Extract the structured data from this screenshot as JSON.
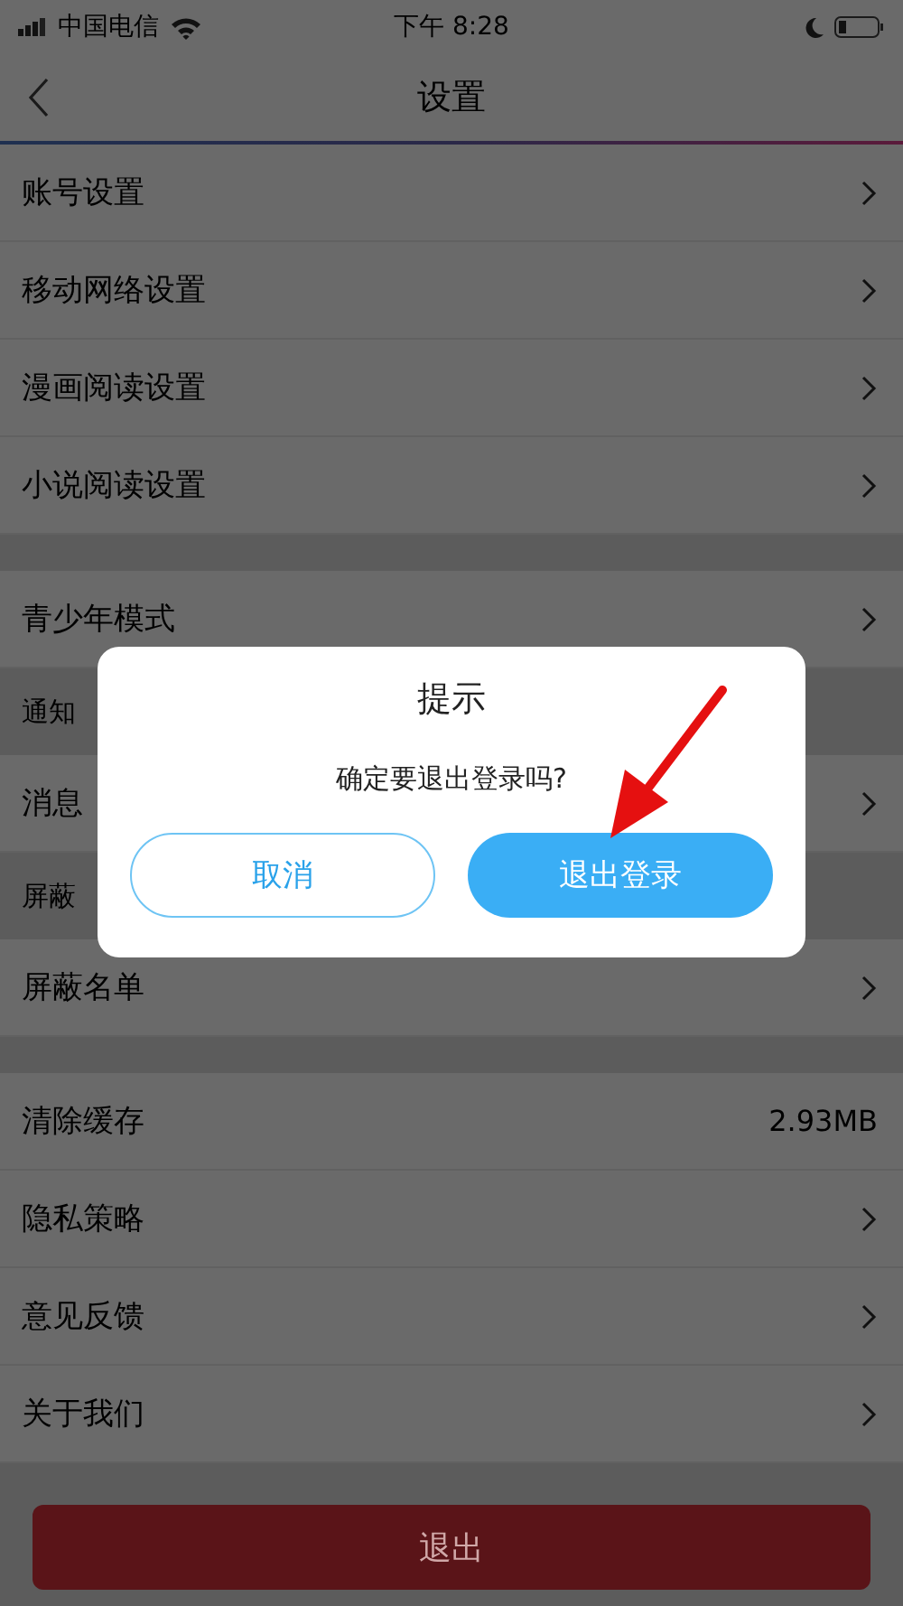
{
  "status_bar": {
    "carrier": "中国电信",
    "time": "下午 8:28"
  },
  "nav": {
    "title": "设置"
  },
  "items": [
    {
      "kind": "row",
      "label": "账号设置",
      "chevron": true
    },
    {
      "kind": "row",
      "label": "移动网络设置",
      "chevron": true
    },
    {
      "kind": "row",
      "label": "漫画阅读设置",
      "chevron": true
    },
    {
      "kind": "row",
      "label": "小说阅读设置",
      "chevron": true
    },
    {
      "kind": "gap"
    },
    {
      "kind": "row",
      "label": "青少年模式",
      "chevron": true
    },
    {
      "kind": "header",
      "label": "通知"
    },
    {
      "kind": "row",
      "label": "消息",
      "chevron": true
    },
    {
      "kind": "header",
      "label": "屏蔽"
    },
    {
      "kind": "row",
      "label": "屏蔽名单",
      "chevron": true
    },
    {
      "kind": "gap"
    },
    {
      "kind": "row",
      "label": "清除缓存",
      "value": "2.93MB",
      "chevron": false
    },
    {
      "kind": "row",
      "label": "隐私策略",
      "chevron": true
    },
    {
      "kind": "row",
      "label": "意见反馈",
      "chevron": true
    },
    {
      "kind": "row",
      "label": "关于我们",
      "chevron": true
    }
  ],
  "logout_button": {
    "label": "退出"
  },
  "dialog": {
    "title": "提示",
    "message": "确定要退出登录吗?",
    "cancel": "取消",
    "confirm": "退出登录"
  }
}
